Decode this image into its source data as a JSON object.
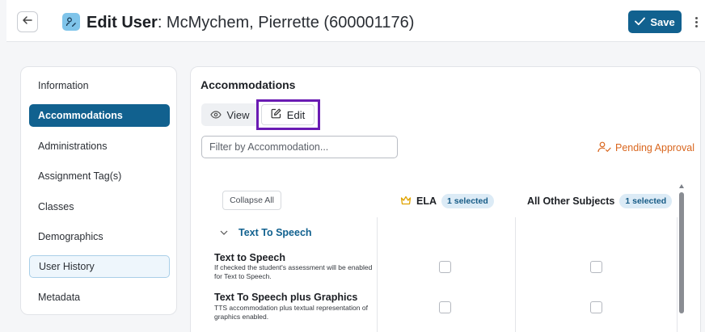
{
  "header": {
    "title_bold": "Edit User",
    "title_rest": ": McMychem, Pierrette (600001176)",
    "save_label": "Save"
  },
  "sidebar": {
    "items": [
      {
        "label": "Information"
      },
      {
        "label": "Accommodations"
      },
      {
        "label": "Administrations"
      },
      {
        "label": "Assignment Tag(s)"
      },
      {
        "label": "Classes"
      },
      {
        "label": "Demographics"
      },
      {
        "label": "User History"
      },
      {
        "label": "Metadata"
      }
    ]
  },
  "main": {
    "title": "Accommodations",
    "view_label": "View",
    "edit_label": "Edit",
    "filter_placeholder": "Filter by Accommodation...",
    "pending_label": "Pending Approval",
    "collapse_label": "Collapse All",
    "columns": [
      {
        "label": "ELA",
        "badge": "1 selected"
      },
      {
        "label": "All Other Subjects",
        "badge": "1 selected"
      }
    ],
    "group": {
      "label": "Text To Speech"
    },
    "rows": [
      {
        "title": "Text to Speech",
        "desc": "If checked the student's assessment will be enabled for Text to Speech."
      },
      {
        "title": "Text To Speech plus Graphics",
        "desc": "TTS accommodation plus textual representation of graphics enabled."
      }
    ]
  },
  "colors": {
    "primary": "#11618f",
    "highlight": "#6a1bb3",
    "pending": "#d9661e",
    "crown": "#e0a300"
  }
}
